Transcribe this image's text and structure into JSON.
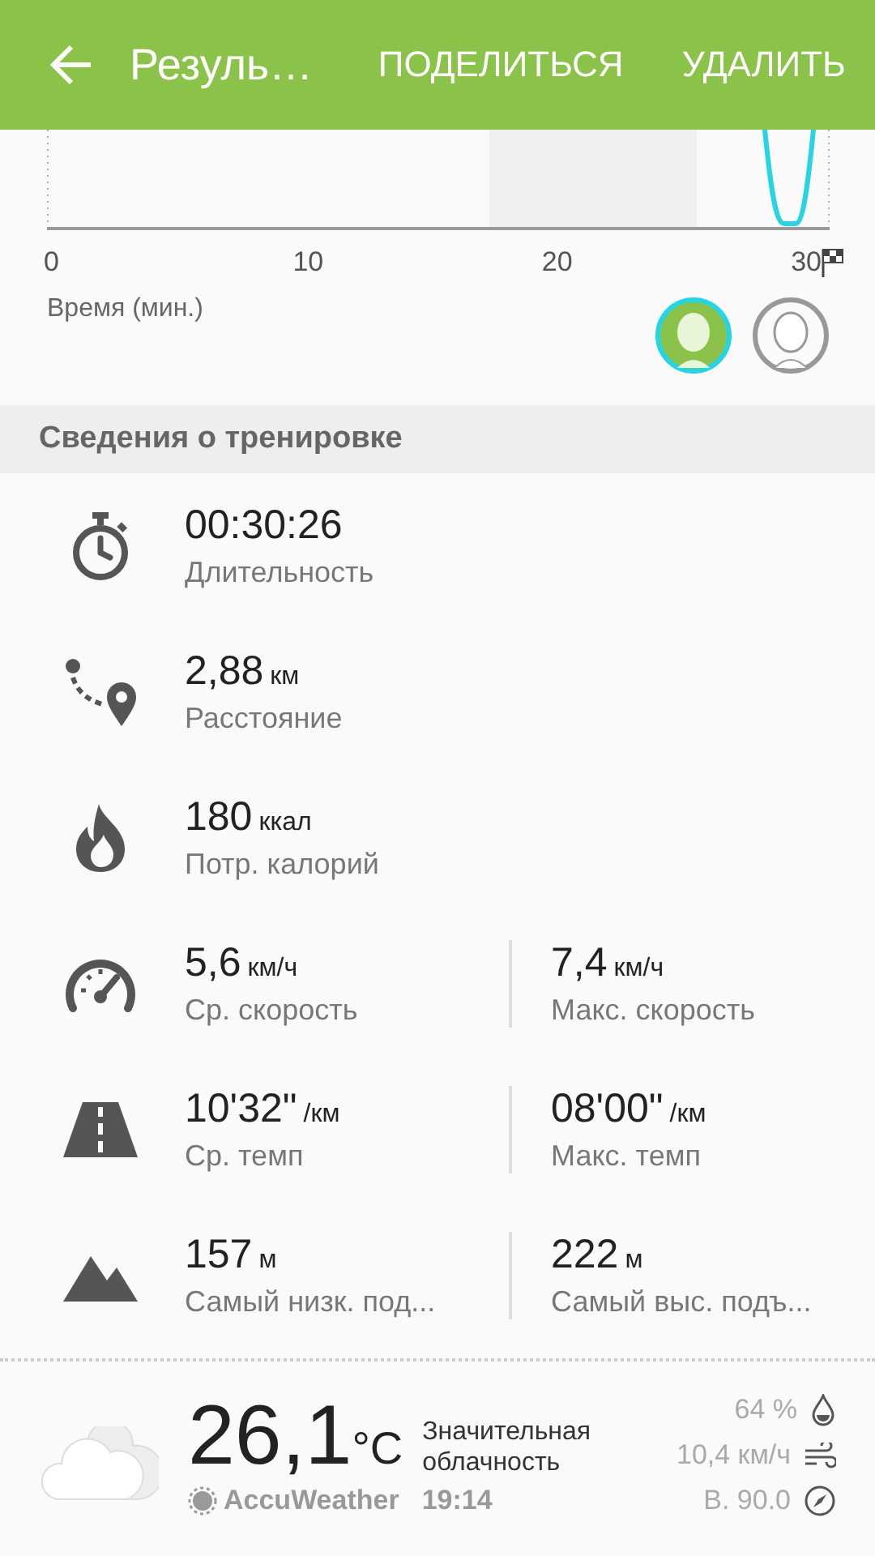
{
  "app_bar": {
    "title": "Резуль…",
    "actions": [
      "ПОДЕЛИТЬСЯ",
      "УДАЛИТЬ"
    ]
  },
  "chart": {
    "xticks": [
      "0",
      "10",
      "20",
      "30"
    ],
    "xlabel": "Время (мин.)"
  },
  "avatars": [
    {
      "selected": true
    },
    {
      "selected": false
    }
  ],
  "section_title": "Сведения о тренировке",
  "stats": [
    {
      "kind": "duration",
      "items": [
        {
          "value": "00:30:26",
          "label": "Длительность"
        }
      ]
    },
    {
      "kind": "distance",
      "items": [
        {
          "value": "2,88",
          "unit": "км",
          "label": "Расстояние"
        }
      ]
    },
    {
      "kind": "calories",
      "items": [
        {
          "value": "180",
          "unit": "ккал",
          "label": "Потр. калорий"
        }
      ]
    },
    {
      "kind": "speed",
      "items": [
        {
          "value": "5,6",
          "unit": "км/ч",
          "label": "Ср. скорость"
        },
        {
          "value": "7,4",
          "unit": "км/ч",
          "label": "Макс. скорость"
        }
      ]
    },
    {
      "kind": "pace",
      "items": [
        {
          "value": "10'32\"",
          "unit": "/км",
          "label": "Ср. темп"
        },
        {
          "value": "08'00\"",
          "unit": "/км",
          "label": "Макс. темп"
        }
      ]
    },
    {
      "kind": "altitude",
      "items": [
        {
          "value": "157",
          "unit": "м",
          "label": "Самый низк. под..."
        },
        {
          "value": "222",
          "unit": "м",
          "label": "Самый выс. подъ..."
        }
      ]
    }
  ],
  "weather": {
    "temperature": "26,1",
    "unit": "°C",
    "description": "Значительная облачность",
    "provider": "AccuWeather",
    "time": "19:14",
    "humidity": "64 %",
    "wind": "10,4 км/ч",
    "direction": "В. 90.0"
  }
}
